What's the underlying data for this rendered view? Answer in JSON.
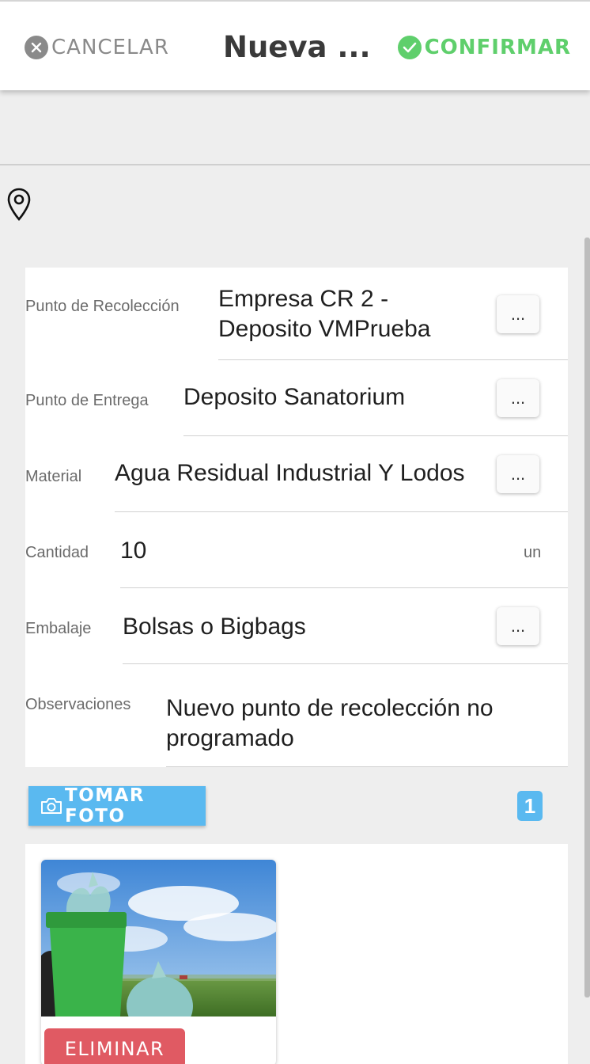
{
  "header": {
    "cancel_label": "CANCELAR",
    "title": "Nueva ...",
    "confirm_label": "CONFIRMAR"
  },
  "form": {
    "punto_recoleccion": {
      "label": "Punto de Recolección",
      "value_line1": "Empresa CR 2 -",
      "value_line2": "Deposito VMPrueba",
      "button": "..."
    },
    "punto_entrega": {
      "label": "Punto de Entrega",
      "value": "Deposito Sanatorium",
      "button": "..."
    },
    "material": {
      "label": "Material",
      "value": "Agua Residual Industrial Y Lodos",
      "button": "..."
    },
    "cantidad": {
      "label": "Cantidad",
      "value": "10",
      "unit": "un"
    },
    "embalaje": {
      "label": "Embalaje",
      "value": "Bolsas o Bigbags",
      "button": "..."
    },
    "observaciones": {
      "label": "Observaciones",
      "value_line1": "Nuevo punto de recolección no",
      "value_line2": "programado"
    }
  },
  "photos": {
    "take_photo_label": "TOMAR FOTO",
    "count": "1",
    "items": [
      {
        "delete_label": "ELIMINAR"
      }
    ]
  },
  "icons": {
    "cancel": "close-circle-icon",
    "confirm": "check-circle-icon",
    "location": "map-pin-icon",
    "camera": "camera-icon"
  },
  "colors": {
    "confirm": "#5fcf6c",
    "cancel": "#8a8a8a",
    "primary": "#5ab9f0",
    "danger": "#e05a63"
  }
}
